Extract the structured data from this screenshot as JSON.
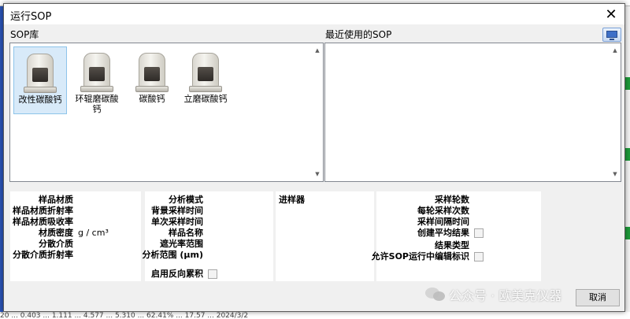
{
  "background": {
    "top_text": "",
    "bottom_text": "20 ... 0.403 ... 1.111 ... 4.577 ... 5.310 ... 62.41% ... 17.57 ... 2024/3/2"
  },
  "dialog": {
    "title": "运行SOP",
    "close_glyph": "✕",
    "sop_library_label": "SOP库",
    "recent_label": "最近使用的SOP",
    "sop_items": [
      {
        "name": "改性碳酸钙",
        "selected": true
      },
      {
        "name": "环辊磨碳酸钙",
        "selected": false
      },
      {
        "name": "碳酸钙",
        "selected": false
      },
      {
        "name": "立磨碳酸钙",
        "selected": false
      }
    ],
    "material_panel": {
      "sample_material": "样品材质",
      "material_refractive": "样品材质折射率",
      "material_absorption": "样品材质吸收率",
      "material_density": "材质密度",
      "density_unit": "g / cm³",
      "dispersant": "分散介质",
      "dispersant_refractive": "分散介质折射率"
    },
    "analysis_panel": {
      "analysis_mode": "分析模式",
      "background_time": "背景采样时间",
      "single_time": "单次采样时间",
      "sample_name": "样品名称",
      "obscuration_range": "遮光率范围",
      "analysis_range": "分析范围 (μm)",
      "reverse_cumulative": "启用反向累积"
    },
    "sampler_panel": {
      "sampler": "进样器"
    },
    "sampling_panel": {
      "rounds": "采样轮数",
      "samples_per_round": "每轮采样次数",
      "interval": "采样间隔时间",
      "create_average": "创建平均结果",
      "result_type": "结果类型",
      "allow_edit_id": "允许SOP运行中编辑标识"
    },
    "cancel_label": "取消"
  },
  "watermark": {
    "text": "公众号 · 欧美克仪器"
  },
  "icons": {
    "close": "close-icon",
    "view": "monitor-view-icon",
    "scroll_up": "scroll-up-arrow-icon",
    "scroll_down": "scroll-down-arrow-icon",
    "instrument": "particle-analyzer-icon"
  },
  "colors": {
    "dialog_bg": "#f0f0f0",
    "selection": "#d8eaf9",
    "selection_border": "#8dc4ea"
  }
}
